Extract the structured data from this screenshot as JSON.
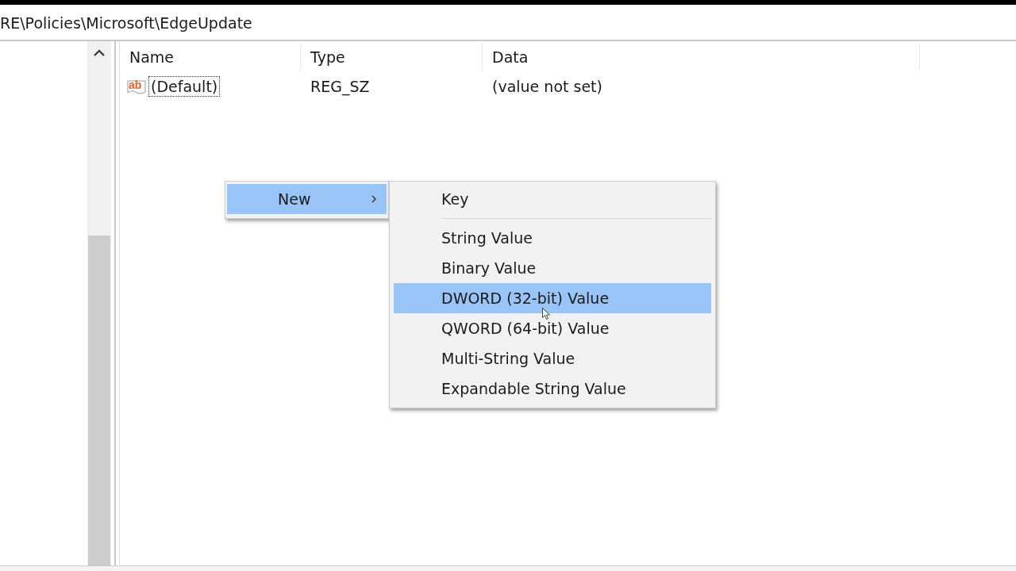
{
  "address_bar": {
    "path": "RE\\Policies\\Microsoft\\EdgeUpdate"
  },
  "list": {
    "columns": [
      "Name",
      "Type",
      "Data"
    ],
    "rows": [
      {
        "icon_text": "ab",
        "name": "(Default)",
        "type": "REG_SZ",
        "data": "(value not set)",
        "focused": true
      }
    ]
  },
  "context_menu": {
    "items": [
      {
        "label": "New",
        "selected": true,
        "has_submenu": true
      }
    ]
  },
  "submenu": {
    "items": [
      {
        "kind": "item",
        "label": "Key",
        "selected": false
      },
      {
        "kind": "separator"
      },
      {
        "kind": "item",
        "label": "String Value",
        "selected": false
      },
      {
        "kind": "item",
        "label": "Binary Value",
        "selected": false
      },
      {
        "kind": "item",
        "label": "DWORD (32-bit) Value",
        "selected": true
      },
      {
        "kind": "item",
        "label": "QWORD (64-bit) Value",
        "selected": false
      },
      {
        "kind": "item",
        "label": "Multi-String Value",
        "selected": false
      },
      {
        "kind": "item",
        "label": "Expandable String Value",
        "selected": false
      }
    ]
  }
}
